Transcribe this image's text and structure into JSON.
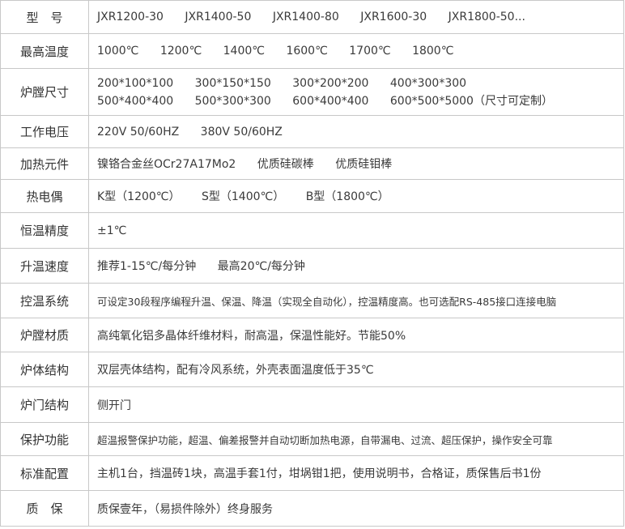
{
  "rows": [
    {
      "label": "型　号",
      "values": [
        "JXR1200-30",
        "JXR1400-50",
        "JXR1400-80",
        "JXR1600-30",
        "JXR1800-50..."
      ]
    },
    {
      "label": "最高温度",
      "values": [
        "1000℃",
        "1200℃",
        "1400℃",
        "1600℃",
        "1700℃",
        "1800℃"
      ]
    },
    {
      "label": "炉膛尺寸",
      "line1": [
        "200*100*100",
        "300*150*150",
        "300*200*200",
        "400*300*300"
      ],
      "line2": [
        "500*400*400",
        "500*300*300",
        "600*400*400",
        "600*500*5000（尺寸可定制）"
      ]
    },
    {
      "label": "工作电压",
      "values": [
        "220V 50/60HZ",
        "380V 50/60HZ"
      ]
    },
    {
      "label": "加热元件",
      "values": [
        "镍铬合金丝OCr27A17Mo2",
        "优质硅碳棒",
        "优质硅钼棒"
      ]
    },
    {
      "label": "热电偶",
      "values": [
        "K型（1200℃）",
        "S型（1400℃）",
        "B型（1800℃）"
      ]
    },
    {
      "label": "恒温精度",
      "text": "±1℃"
    },
    {
      "label": "升温速度",
      "values": [
        "推荐1-15℃/每分钟",
        "最高20℃/每分钟"
      ]
    },
    {
      "label": "控温系统",
      "text": "可设定30段程序编程升温、保温、降温（实现全自动化），控温精度高。也可选配RS-485接口连接电脑"
    },
    {
      "label": "炉膛材质",
      "text": "高纯氧化铝多晶体纤维材料，耐高温，保温性能好。节能50%"
    },
    {
      "label": "炉体结构",
      "text": "双层壳体结构，配有冷风系统，外壳表面温度低于35℃"
    },
    {
      "label": "炉门结构",
      "text": "侧开门"
    },
    {
      "label": "保护功能",
      "text": "超温报警保护功能，超温、偏差报警并自动切断加热电源，自带漏电、过流、超压保护，操作安全可靠"
    },
    {
      "label": "标准配置",
      "text": "主机1台，挡温砖1块，高温手套1付，坩埚钳1把，使用说明书，合格证，质保售后书1份"
    },
    {
      "label": "质　保",
      "text": "质保壹年，（易损件除外）终身服务"
    }
  ]
}
